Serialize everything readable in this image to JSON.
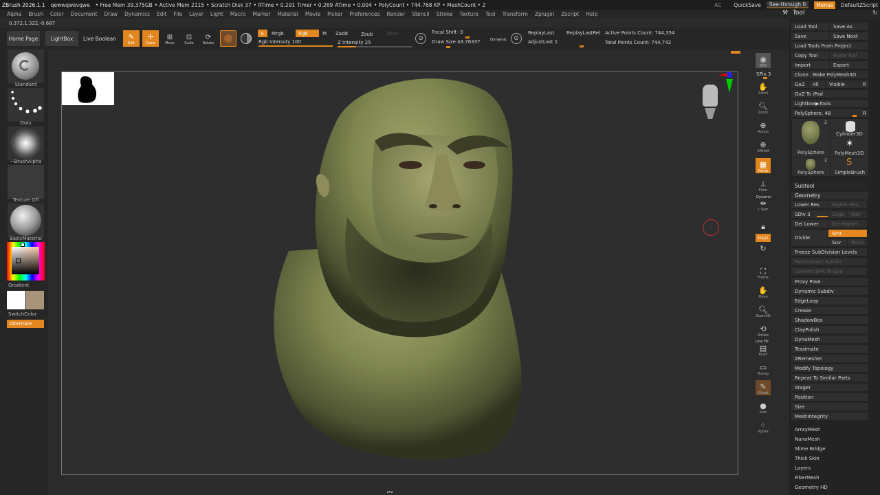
{
  "titlebar": {
    "app": "ZBrush 2026.1.1",
    "document": "qewwqwevqwe",
    "free_mem": "• Free Mem 39.375GB",
    "active_mem": "• Active Mem 2115",
    "scratch": "• Scratch Disk 37",
    "rtime": "• RTime • 0.291",
    "timer": "Timer • 0.269",
    "atime": "ATime • 0.004",
    "polycount": "• PolyCount • 744.768 KP",
    "meshcount": "• MeshCount • 2",
    "ac": "AC",
    "quicksave": "QuickSave",
    "see_through": "See-through 0",
    "menus": "Menus",
    "script": "DefaultZScript"
  },
  "menubar": [
    "Alpha",
    "Brush",
    "Color",
    "Document",
    "Draw",
    "Dynamics",
    "Edit",
    "File",
    "Layer",
    "Light",
    "Macro",
    "Marker",
    "Material",
    "Movie",
    "Picker",
    "Preferences",
    "Render",
    "Stencil",
    "Stroke",
    "Texture",
    "Tool",
    "Transform",
    "Zplugin",
    "Zscript",
    "Help"
  ],
  "tool_palette_title": "Tool",
  "coordinates": "0.372,1.322,-0.687",
  "shelf": {
    "home_page": "Home Page",
    "lightbox": "LightBox",
    "live_boolean": "Live Boolean",
    "edit": "Edit",
    "draw": "Draw",
    "move": "Move",
    "scale": "Scale",
    "rotate": "Rotate",
    "a": "A",
    "mrgb": "Mrgb",
    "rgb": "Rgb",
    "m": "M",
    "zadd": "Zadd",
    "zsub": "Zsub",
    "zcut": "Zcut",
    "rgb_intensity": "Rgb Intensity 100",
    "z_intensity": "Z Intensity 25",
    "focal_shift": "Focal Shift -3",
    "draw_size": "Draw Size 43.76337",
    "dynamic": "Dynamic",
    "replay_last": "ReplayLast",
    "replay_last_rel": "ReplayLastRel",
    "adjust_last": "AdjustLast 1",
    "active_points": "Active Points Count: 744,354",
    "total_points": "Total Points Count: 744,742",
    "rgb_intensity_value": 100,
    "z_intensity_value": 25
  },
  "left": {
    "brush": "Standard",
    "stroke": "Dots",
    "alpha": "~BrushAlpha",
    "texture": "Texture Off",
    "material": "BasicMaterial",
    "gradient": "Gradient",
    "switch_color": "SwitchColor",
    "alternate": "Alternate",
    "main_color": "#ffffff",
    "secondary_color": "#a89479"
  },
  "right_shelf": {
    "bpr": "BPR",
    "spix": "SPix 3",
    "scroll": "Scroll",
    "zoom": "Zoom",
    "actual": "Actual",
    "aahalf": "AAHalf",
    "persp": "Persp",
    "floor": "Floor",
    "dynamic": "Dynamic",
    "lsym": "L.Sym",
    "gxyz": "Gxyz",
    "frame": "Frame",
    "move": "Move",
    "zoom3d": "Zoom3D",
    "rotate": "Rotate",
    "line_fill": "Line Fill",
    "polyf": "PolyF",
    "transp": "Transp",
    "ghost": "Ghost",
    "solo": "Solo",
    "xpose": "Xpose"
  },
  "tool": {
    "load_tool": "Load Tool",
    "save_as": "Save As",
    "save": "Save",
    "save_next": "Save Next",
    "load_from_project": "Load Tools From Project",
    "copy_tool": "Copy Tool",
    "paste_tool": "Paste Tool",
    "import": "Import",
    "export": "Export",
    "clone": "Clone",
    "make_polymesh": "Make PolyMesh3D",
    "goz": "GoZ",
    "all": "All",
    "visible": "Visible",
    "r": "R",
    "goz_ipad": "GoZ To iPad",
    "lightbox_tools": "Lightbox▶Tools",
    "polysphere_slider": "PolySphere. 48",
    "thumbs": [
      {
        "name": "PolySphere",
        "count": "2"
      },
      {
        "name": "Cylinder3D",
        "count": ""
      },
      {
        "name": "PolyMesh3D",
        "count": ""
      },
      {
        "name": "PolySphere",
        "count": "2"
      },
      {
        "name": "SimpleBrush",
        "count": ""
      }
    ],
    "subtool": "Subtool",
    "geometry": "Geometry",
    "lower_res": "Lower Res",
    "higher_res": "Higher Res",
    "sdiv": "SDiv 3",
    "cage": "Cage",
    "rstr": "Rstr",
    "del_lower": "Del Lower",
    "del_higher": "Del Higher",
    "divide": "Divide",
    "smt": "Smt",
    "suv": "Suv",
    "reuv": "ReUV",
    "freeze": "Freeze SubDivision Levels",
    "reconstruct": "Reconstruct Subdiv",
    "convert_bpr": "Convert BPR To Geo",
    "geometry_items": [
      "Proxy Pose",
      "Dynamic Subdiv",
      "EdgeLoop",
      "Crease",
      "ShadowBox",
      "ClayPolish",
      "DynaMesh",
      "Tessimate",
      "ZRemesher",
      "Modify Topology",
      "Repeat To Similar Parts",
      "Stager",
      "Position",
      "Size",
      "MeshIntegrity"
    ],
    "lower_items": [
      "ArrayMesh",
      "NanoMesh",
      "Slime Bridge",
      "Thick Skin",
      "Layers",
      "FiberMesh",
      "Geometry HD"
    ]
  }
}
